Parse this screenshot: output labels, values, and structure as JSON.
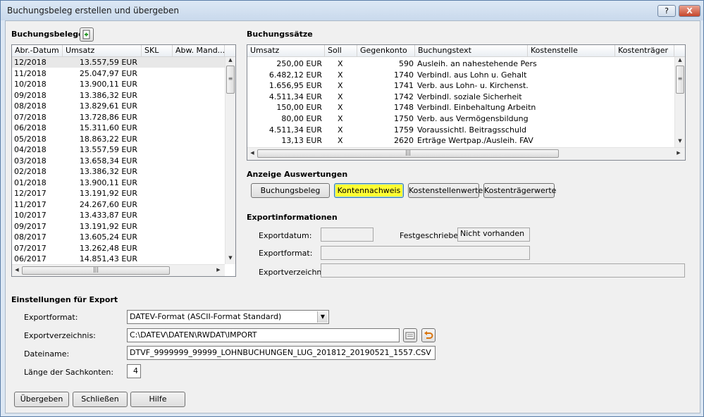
{
  "window": {
    "title": "Buchungsbeleg erstellen und übergeben",
    "help_label": "?",
    "close_label": "X"
  },
  "belege": {
    "title": "Buchungsbelege",
    "columns": [
      "Abr.-Datum",
      "Umsatz",
      "SKL",
      "Abw. Mand..."
    ],
    "rows": [
      [
        "12/2018",
        "13.557,59 EUR"
      ],
      [
        "11/2018",
        "25.047,97 EUR"
      ],
      [
        "10/2018",
        "13.900,11 EUR"
      ],
      [
        "09/2018",
        "13.386,32 EUR"
      ],
      [
        "08/2018",
        "13.829,61 EUR"
      ],
      [
        "07/2018",
        "13.728,86 EUR"
      ],
      [
        "06/2018",
        "15.311,60 EUR"
      ],
      [
        "05/2018",
        "18.863,22 EUR"
      ],
      [
        "04/2018",
        "13.557,59 EUR"
      ],
      [
        "03/2018",
        "13.658,34 EUR"
      ],
      [
        "02/2018",
        "13.386,32 EUR"
      ],
      [
        "01/2018",
        "13.900,11 EUR"
      ],
      [
        "12/2017",
        "13.191,92 EUR"
      ],
      [
        "11/2017",
        "24.267,60 EUR"
      ],
      [
        "10/2017",
        "13.433,87 EUR"
      ],
      [
        "09/2017",
        "13.191,92 EUR"
      ],
      [
        "08/2017",
        "13.605,24 EUR"
      ],
      [
        "07/2017",
        "13.262,48 EUR"
      ],
      [
        "06/2017",
        "14.851,43 EUR"
      ]
    ]
  },
  "saetze": {
    "title": "Buchungssätze",
    "columns": [
      "Umsatz",
      "Soll",
      "Gegenkonto",
      "Buchungstext",
      "Kostenstelle",
      "Kostenträger"
    ],
    "rows": [
      [
        "250,00 EUR",
        "X",
        "590",
        "Ausleih. an nahestehende Pers."
      ],
      [
        "6.482,12 EUR",
        "X",
        "1740",
        "Verbindl. aus Lohn u. Gehalt"
      ],
      [
        "1.656,95 EUR",
        "X",
        "1741",
        "Verb. aus Lohn- u. Kirchenst."
      ],
      [
        "4.511,34 EUR",
        "X",
        "1742",
        "Verbindl. soziale Sicherheit"
      ],
      [
        "150,00 EUR",
        "X",
        "1748",
        "Verbindl. Einbehaltung Arbeitn"
      ],
      [
        "80,00 EUR",
        "X",
        "1750",
        "Verb. aus Vermögensbildung"
      ],
      [
        "4.511,34 EUR",
        "X",
        "1759",
        "Voraussichtl. Beitragsschuld"
      ],
      [
        "13,13 EUR",
        "X",
        "2620",
        "Erträge Wertpap./Ausleih. FAV"
      ]
    ]
  },
  "auswertungen": {
    "title": "Anzeige Auswertungen",
    "buttons": [
      "Buchungsbeleg",
      "Kontennachweis",
      "Kostenstellenwerte",
      "Kostenträgerwerte"
    ],
    "active": "Kontennachweis",
    "active_color": "#ffff33"
  },
  "exportinfo": {
    "title": "Exportinformationen",
    "datum_label": "Exportdatum:",
    "datum_value": "",
    "fest_label": "Festgeschrieben:",
    "fest_value": "Nicht vorhanden",
    "format_label": "Exportformat:",
    "format_value": "",
    "verz_label": "Exportverzeichnis:",
    "verz_value": ""
  },
  "settings": {
    "title": "Einstellungen für Export",
    "format_label": "Exportformat:",
    "format_value": "DATEV-Format (ASCII-Format Standard)",
    "verz_label": "Exportverzeichnis:",
    "verz_value": "C:\\DATEV\\DATEN\\RWDAT\\IMPORT",
    "datei_label": "Dateiname:",
    "datei_value": "DTVF_9999999_99999_LOHNBUCHUNGEN_LUG_201812_20190521_1557.CSV",
    "laenge_label": "Länge der Sachkonten:",
    "laenge_value": "4"
  },
  "footer": {
    "uebergeben": "Übergeben",
    "schliessen": "Schließen",
    "hilfe": "Hilfe"
  },
  "icons": {
    "add_beleg": "add-document-icon",
    "browse": "folder-browse-icon",
    "reset": "undo-arrow-icon"
  }
}
